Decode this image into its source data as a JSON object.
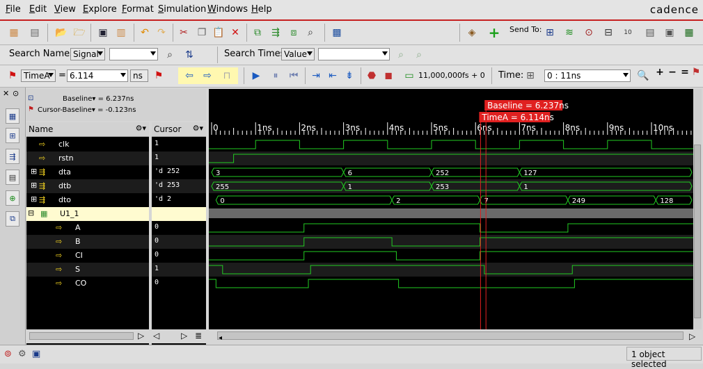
{
  "menu": [
    "File",
    "Edit",
    "View",
    "Explore",
    "Format",
    "Simulation",
    "Windows",
    "Help"
  ],
  "brand": "cadence",
  "toolbar": {
    "send_to_label": "Send To:"
  },
  "search": {
    "names_label": "Search Names:",
    "names_mode": "Signal",
    "names_value": "",
    "times_label": "Search Times:",
    "times_mode": "Value",
    "times_value": ""
  },
  "cursor_bar": {
    "cursor_name": "TimeA",
    "equals": "=",
    "time_value": "6.114",
    "time_unit": "ns",
    "sim_time": "11,000,000fs + 0",
    "time_label": "Time:",
    "time_range": "0 : 11ns"
  },
  "markers": {
    "baseline_info": "Baseline▾ = 6.237ns",
    "cursor_baseline_info": "Cursor-Baseline▾ = -0.123ns",
    "baseline_tag": "Baseline = 6.237ns",
    "timea_tag": "TimeA = 6.114ns"
  },
  "columns": {
    "name": "Name",
    "cursor": "Cursor"
  },
  "timeline": {
    "start": 0,
    "end": 11,
    "ticks": [
      "0",
      "1ns",
      "2ns",
      "3ns",
      "4ns",
      "5ns",
      "6ns",
      "7ns",
      "8ns",
      "9ns",
      "10ns"
    ],
    "baseline": 6.237,
    "cursor": 6.114
  },
  "signals": [
    {
      "name": "clk",
      "value": "1",
      "type": "bit",
      "indent": 1
    },
    {
      "name": "rstn",
      "value": "1",
      "type": "bit",
      "indent": 1
    },
    {
      "name": "dta",
      "value": "'d 252",
      "type": "bus",
      "indent": 1
    },
    {
      "name": "dtb",
      "value": "'d 253",
      "type": "bus",
      "indent": 1
    },
    {
      "name": "dto",
      "value": "'d 2",
      "type": "bus",
      "indent": 1
    },
    {
      "name": "U1_1",
      "value": "",
      "type": "group",
      "indent": 0
    },
    {
      "name": "A",
      "value": "0",
      "type": "bit",
      "indent": 2
    },
    {
      "name": "B",
      "value": "0",
      "type": "bit",
      "indent": 2
    },
    {
      "name": "CI",
      "value": "0",
      "type": "bit",
      "indent": 2
    },
    {
      "name": "S",
      "value": "1",
      "type": "bit",
      "indent": 2
    },
    {
      "name": "CO",
      "value": "0",
      "type": "bit",
      "indent": 2
    }
  ],
  "waves": {
    "clk": {
      "initial": 0,
      "edges": [
        1,
        2,
        3,
        4,
        5,
        6,
        7,
        8,
        9,
        10
      ]
    },
    "rstn": {
      "initial": 0,
      "edges": [
        0.5
      ]
    },
    "A": {
      "initial": 0,
      "edges": [
        2.1,
        6.1,
        8.1
      ]
    },
    "B": {
      "initial": 0,
      "edges": [
        2.1,
        4.1,
        6.1
      ]
    },
    "CI": {
      "initial": 0,
      "edges": [
        2.1,
        4.2,
        6.1
      ]
    },
    "S": {
      "initial": 1,
      "edges": [
        0.25,
        2.25,
        6.2,
        8.2
      ]
    },
    "CO": {
      "initial": 1,
      "edges": [
        0.1,
        2.2,
        4.25,
        8.25
      ]
    },
    "dta": [
      {
        "from": 0,
        "to": 3,
        "v": "3"
      },
      {
        "from": 3,
        "to": 5,
        "v": "6"
      },
      {
        "from": 5,
        "to": 7,
        "v": "252"
      },
      {
        "from": 7,
        "to": 11,
        "v": "127"
      }
    ],
    "dtb": [
      {
        "from": 0,
        "to": 3,
        "v": "255"
      },
      {
        "from": 3,
        "to": 5,
        "v": "1"
      },
      {
        "from": 5,
        "to": 7,
        "v": "253"
      },
      {
        "from": 7,
        "to": 11,
        "v": "1"
      }
    ],
    "dto": [
      {
        "from": 0.1,
        "to": 4.1,
        "v": "0"
      },
      {
        "from": 4.1,
        "to": 6.1,
        "v": "2"
      },
      {
        "from": 6.1,
        "to": 8.1,
        "v": "7"
      },
      {
        "from": 8.1,
        "to": 10.1,
        "v": "249"
      },
      {
        "from": 10.1,
        "to": 11,
        "v": "128"
      }
    ]
  },
  "colors": {
    "wave": "#22cc22",
    "cursor": "#e02020",
    "group_row": "#fffbd0"
  },
  "status": {
    "selection": "1 object selected"
  }
}
